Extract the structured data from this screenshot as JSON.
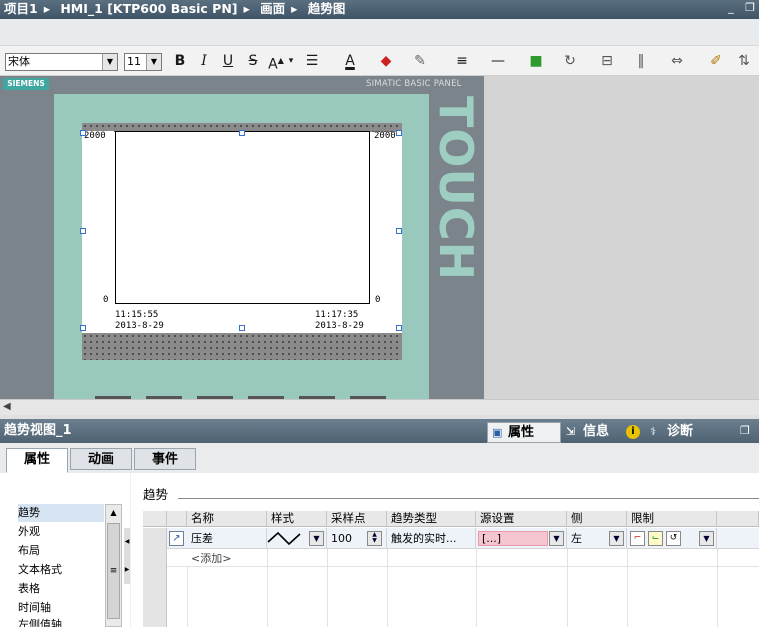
{
  "breadcrumb": [
    "项目1",
    "HMI_1 [KTP600 Basic PN]",
    "画面",
    "趋势图"
  ],
  "window_controls": [
    "_",
    "❐"
  ],
  "toolbar": {
    "font_name": "宋体",
    "font_size": "11",
    "bold": "B",
    "italic": "I",
    "underline": "U",
    "strike": "S",
    "font_grow": "A",
    "font_color": "A"
  },
  "hmi_panel": {
    "brand": "SIEMENS",
    "model_label": "SIMATIC BASIC PANEL",
    "touch_label": "TOUCH"
  },
  "trend_view": {
    "y_max_left": "2000",
    "y_max_right": "2000",
    "y_min_left": "0",
    "y_min_right": "0",
    "x_start_time": "11:15:55",
    "x_start_date": "2013-8-29",
    "x_end_time": "11:17:35",
    "x_end_date": "2013-8-29"
  },
  "inspector": {
    "title": "趋势视图_1",
    "top_tabs": [
      "属性",
      "信息",
      "诊断"
    ],
    "tabs": [
      "属性",
      "动画",
      "事件"
    ],
    "nav_items": [
      "趋势",
      "外观",
      "布局",
      "文本格式",
      "表格",
      "时间轴",
      "左侧值轴"
    ],
    "section_title": "趋势",
    "columns": [
      "名称",
      "样式",
      "采样点",
      "趋势类型",
      "源设置",
      "侧",
      "限制"
    ],
    "row": {
      "name": "压差",
      "sample_points": "100",
      "trend_type": "触发的实时...",
      "source": "[...]",
      "side": "左"
    },
    "add_label": "<添加>"
  }
}
